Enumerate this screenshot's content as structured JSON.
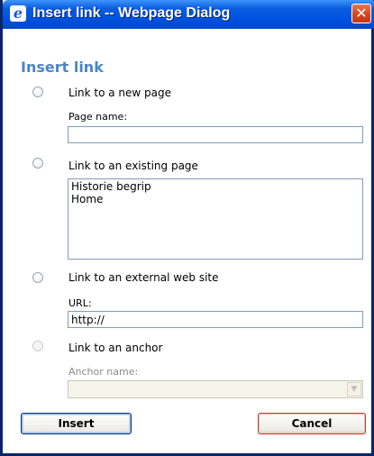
{
  "window": {
    "title": "Insert link -- Webpage Dialog",
    "close_glyph": "✕"
  },
  "dialog": {
    "heading": "Insert link",
    "options": {
      "new_page": {
        "label": "Link to a new page",
        "field_label": "Page name:",
        "value": ""
      },
      "existing_page": {
        "label": "Link to an existing page",
        "pages": [
          "Historie begrip",
          "Home"
        ]
      },
      "external": {
        "label": "Link to an external web site",
        "field_label": "URL:",
        "value": "http://"
      },
      "anchor": {
        "label": "Link to an anchor",
        "field_label": "Anchor name:",
        "value": "",
        "enabled": false
      }
    },
    "buttons": {
      "insert": "Insert",
      "cancel": "Cancel"
    }
  },
  "colors": {
    "titlebar": "#0054e3",
    "heading": "#4a86c5",
    "input_border": "#7f9db9"
  },
  "icons": {
    "app": "ie-icon",
    "close": "close-icon"
  }
}
